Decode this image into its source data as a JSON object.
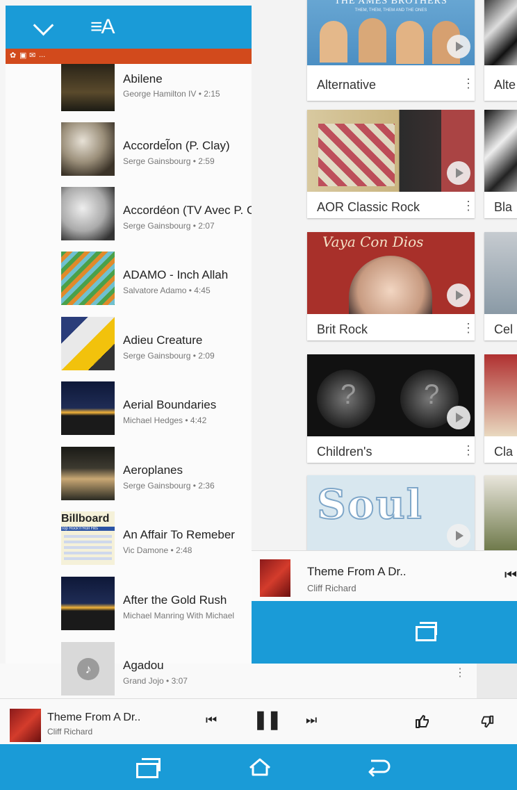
{
  "grid_window": {
    "tiles": [
      {
        "label": "Alternative",
        "more": "⋮"
      },
      {
        "label": "AOR Classic Rock",
        "more": "⋮"
      },
      {
        "label": "Brit Rock",
        "more": "⋮"
      },
      {
        "label": "Children's",
        "more": "⋮"
      },
      {
        "label": "",
        "more": ""
      }
    ],
    "side_tiles": [
      "Alte",
      "Bla",
      "Cel",
      "Cla",
      ""
    ],
    "art_texts": {
      "top_banner": "THE AMES BROTHERS",
      "top_sub": "THEM, THEM, THEM AND THE ONES",
      "script": "Vaya Con Dios",
      "soul": "Soul",
      "q1": "?",
      "q2": "?"
    },
    "now_playing": {
      "title": "Theme From A Dr..",
      "artist": "Cliff Richard",
      "prev": "⏮"
    }
  },
  "list_window": {
    "appbar": {
      "collapse_icon": "chevron-down-icon",
      "sort_label": "≡A"
    },
    "notif_icons": [
      "✿",
      "▣",
      "✉",
      "..."
    ],
    "songs": [
      {
        "title": "Abilene",
        "subtitle": "George Hamilton IV • 2:15"
      },
      {
        "title": "Accordel̃on (P. Clay)",
        "subtitle": "Serge Gainsbourg • 2:59"
      },
      {
        "title": "Accordéon (TV Avec P. C",
        "subtitle": "Serge Gainsbourg • 2:07"
      },
      {
        "title": "ADAMO - Inch Allah",
        "subtitle": "Salvatore Adamo • 4:45"
      },
      {
        "title": "Adieu Creature",
        "subtitle": "Serge Gainsbourg • 2:09"
      },
      {
        "title": "Aerial Boundaries",
        "subtitle": "Michael Hedges • 4:42"
      },
      {
        "title": "Aeroplanes",
        "subtitle": "Serge Gainsbourg • 2:36"
      },
      {
        "title": "An Affair To Remeber",
        "subtitle": "Vic Damone • 2:48"
      },
      {
        "title": "After the Gold Rush",
        "subtitle": "Michael Manring With Michael"
      },
      {
        "title": "Agadou",
        "subtitle": "Grand Jojo • 3:07"
      }
    ],
    "cover_texts": {
      "billboard": "Billboard",
      "billboard_sub": "Top Rock'n'Roll Hits",
      "more": "⋮"
    }
  },
  "player": {
    "title": "Theme From A Dr..",
    "artist": "Cliff Richard",
    "prev": "⏮",
    "pause": "❚❚",
    "next": "⏭"
  },
  "colors": {
    "accent": "#1a9bd7",
    "notif": "#d24a1c"
  }
}
